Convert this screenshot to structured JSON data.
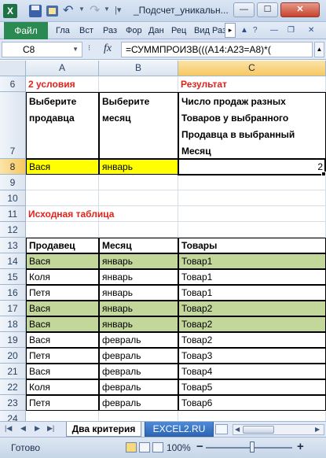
{
  "window": {
    "title": "_Подсчет_уникальн...",
    "app_icon_letter": "X",
    "minimize": "—",
    "maximize": "☐",
    "close": "✕"
  },
  "ribbon": {
    "file_tab": "Файл",
    "tabs": [
      "Гла",
      "Вст",
      "Раз",
      "Фор",
      "Дан",
      "Рец",
      "Вид",
      "Раз"
    ],
    "scroll": "▸"
  },
  "formula_bar": {
    "name_box": "C8",
    "formula": "=СУММПРОИЗВ(((A14:A23=A8)*("
  },
  "columns": [
    "A",
    "B",
    "C"
  ],
  "rows": [
    "6",
    "7",
    "8",
    "9",
    "10",
    "11",
    "12",
    "13",
    "14",
    "15",
    "16",
    "17",
    "18",
    "19",
    "20",
    "21",
    "22",
    "23",
    "24"
  ],
  "section_conditions": {
    "title": "2 условия",
    "result_title": "Результат",
    "header_seller": "Выберите продавца",
    "header_month": "Выберите месяц",
    "header_result": "Число продаж разных Товаров у выбранного Продавца в выбранный Месяц",
    "seller_value": "Вася",
    "month_value": "январь",
    "result_value": "2"
  },
  "source_table": {
    "title": "Исходная таблица",
    "headers": [
      "Продавец",
      "Месяц",
      "Товары"
    ],
    "rows": [
      [
        "Вася",
        "январь",
        "Товар1"
      ],
      [
        "Коля",
        "январь",
        "Товар1"
      ],
      [
        "Петя",
        "январь",
        "Товар1"
      ],
      [
        "Вася",
        "январь",
        "Товар2"
      ],
      [
        "Вася",
        "январь",
        "Товар2"
      ],
      [
        "Вася",
        "февраль",
        "Товар2"
      ],
      [
        "Петя",
        "февраль",
        "Товар3"
      ],
      [
        "Вася",
        "февраль",
        "Товар4"
      ],
      [
        "Коля",
        "февраль",
        "Товар5"
      ],
      [
        "Петя",
        "февраль",
        "Товар6"
      ]
    ],
    "highlighted_rows": [
      0,
      3,
      4
    ],
    "highlight_color": "#c4d79b"
  },
  "sheet_tabs": {
    "active": "Два критерия",
    "other": "EXCEL2.RU"
  },
  "status_bar": {
    "ready": "Готово",
    "zoom": "100%"
  },
  "colors": {
    "accent_green": "#2a8a52",
    "selection_yellow": "#ffff00",
    "title_red": "#e0231b"
  }
}
